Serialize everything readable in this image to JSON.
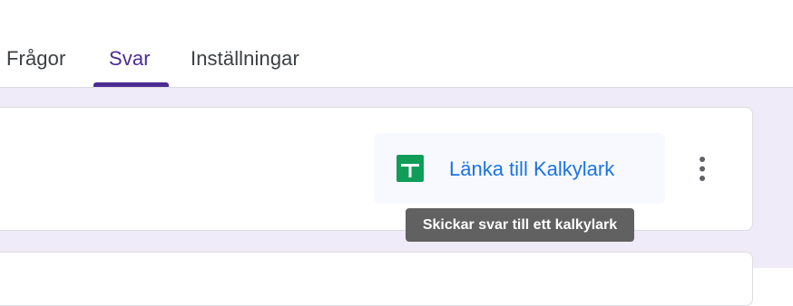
{
  "tabs": {
    "questions": "Frågor",
    "responses": "Svar",
    "settings": "Inställningar",
    "active": "Svar"
  },
  "responses_card": {
    "link_sheets_label": "Länka till Kalkylark",
    "link_sheets_icon": "google-sheets-icon",
    "more_options_icon": "more-vert-icon",
    "tooltip": "Skickar svar till ett kalkylark"
  },
  "colors": {
    "accent": "#4c2c92",
    "link": "#1a73e8",
    "sheets_green": "#0f9d58",
    "background": "#f0ebf8",
    "tooltip_bg": "#616161"
  }
}
